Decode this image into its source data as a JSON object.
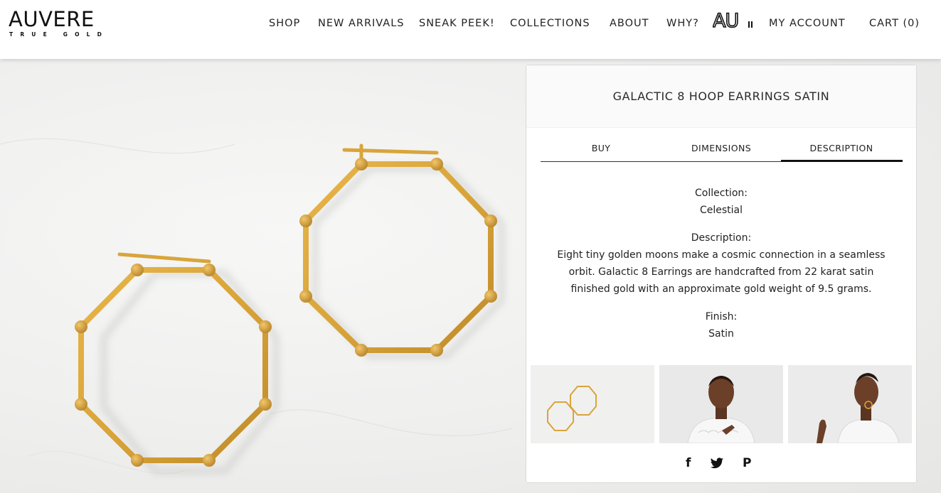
{
  "brand": {
    "name": "AUVERE",
    "tagline": "TRUE GOLD"
  },
  "nav": {
    "shop": "SHOP",
    "new_arrivals": "NEW ARRIVALS",
    "sneak_peek": "SNEAK PEEK!",
    "collections": "COLLECTIONS",
    "about": "ABOUT",
    "why": "WHY?",
    "au_logo_text": "AU",
    "my_account": "MY ACCOUNT",
    "cart": "CART (0)"
  },
  "product": {
    "title": "GALACTIC 8 HOOP EARRINGS SATIN",
    "tabs": [
      "BUY",
      "DIMENSIONS",
      "DESCRIPTION"
    ],
    "active_tab": "DESCRIPTION",
    "collection_label": "Collection:",
    "collection_value": "Celestial",
    "description_label": "Description:",
    "description_value": "Eight tiny golden moons make a cosmic connection in a seamless orbit. Galactic 8 Earrings are handcrafted from 22 karat satin finished gold with an approximate gold weight of 9.5 grams.",
    "finish_label": "Finish:",
    "finish_value": "Satin"
  },
  "social": {
    "facebook": "f",
    "twitter_icon": "twitter-bird",
    "pinterest": "P"
  },
  "colors": {
    "gold": "#d9a53a",
    "gold_dark": "#b9862a",
    "ink": "#222222",
    "panel_border": "#d9d9d9"
  }
}
